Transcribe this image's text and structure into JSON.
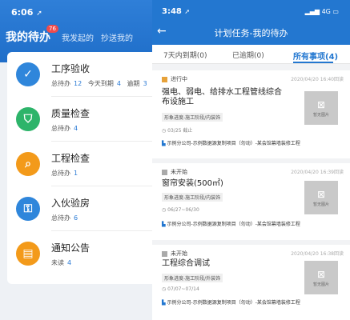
{
  "left": {
    "time": "6:06",
    "tabs": {
      "active": "我的待办",
      "badge": "76",
      "t2": "我发起的",
      "t3": "抄送我的"
    },
    "items": [
      {
        "title": "工序验收",
        "icon": "check-icon",
        "color": "#2f86db",
        "sub": [
          [
            "总待办",
            "12"
          ],
          [
            "今天到期",
            "4"
          ],
          [
            "逾期",
            "3"
          ]
        ]
      },
      {
        "title": "质量检查",
        "icon": "shield-icon",
        "color": "#2db46a",
        "sub": [
          [
            "总待办",
            "4"
          ]
        ]
      },
      {
        "title": "工程检查",
        "icon": "search-icon",
        "color": "#f39a1a",
        "sub": [
          [
            "总待办",
            "1"
          ]
        ]
      },
      {
        "title": "入伙验房",
        "icon": "key-icon",
        "color": "#2f86db",
        "sub": [
          [
            "总待办",
            "6"
          ]
        ]
      },
      {
        "title": "通知公告",
        "icon": "notice-icon",
        "color": "#f39a1a",
        "sub": [
          [
            "未读",
            "4"
          ]
        ]
      }
    ]
  },
  "right": {
    "time": "3:48",
    "status": "4G",
    "title": "计划任务-我的待办",
    "tabs": [
      "7天内到期(0)",
      "已逾期(0)",
      "所有事项(4)"
    ],
    "image_caption": "暂无图片",
    "cards": [
      {
        "status": "进行中",
        "status_color": "#e7a23a",
        "date": "2020/04/20 16:40回读",
        "title": "强电、弱电、给排水工程管线综合布设施工",
        "tag": "形象进度-施工阶段/内装饰",
        "range": "03/25 截止",
        "org": "示例分公司-示例数据源复制项目（勿动）-某会馆幕墙装修工程"
      },
      {
        "status": "未开始",
        "status_color": "#aaaaaa",
        "date": "2020/04/20 16:39回读",
        "title": "窗帘安装(500㎡)",
        "tag": "形象进度-施工阶段/内装饰",
        "range": "06/27~06/30",
        "org": "示例分公司-示例数据源复制项目（勿动）-某会馆幕墙装修工程"
      },
      {
        "status": "未开始",
        "status_color": "#aaaaaa",
        "date": "2020/04/20 16:38回读",
        "title": "工程综合调试",
        "tag": "形象进度-施工阶段/外装饰",
        "range": "07/07~07/14",
        "org": "示例分公司-示例数据源复制项目（勿动）-某会馆幕墙装修工程"
      }
    ]
  }
}
